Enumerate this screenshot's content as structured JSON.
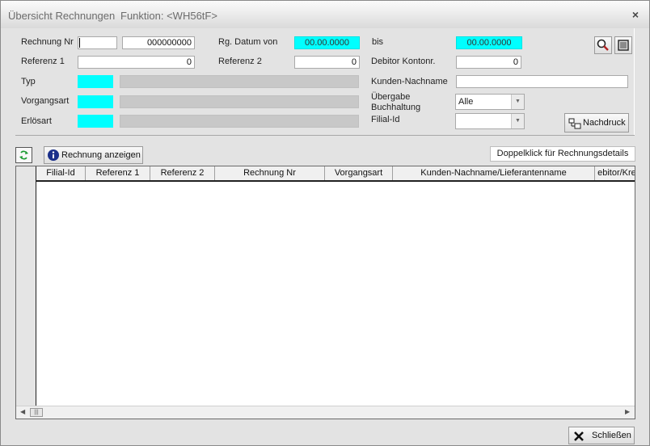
{
  "window": {
    "title": "Übersicht Rechnungen",
    "function_label": "Funktion: <WH56tF>",
    "close_glyph": "×"
  },
  "filters": {
    "rechnung_nr_label": "Rechnung Nr",
    "rechnung_nr_prefix": "",
    "rechnung_nr_value": "000000000",
    "rg_datum_von_label": "Rg. Datum von",
    "rg_datum_von_value": "00.00.0000",
    "bis_label": "bis",
    "bis_value": "00.00.0000",
    "referenz1_label": "Referenz 1",
    "referenz1_value": "0",
    "referenz2_label": "Referenz 2",
    "referenz2_value": "0",
    "debitor_label": "Debitor Kontonr.",
    "debitor_value": "0",
    "typ_label": "Typ",
    "kunden_nachname_label": "Kunden-Nachname",
    "kunden_nachname_value": "",
    "vorgangsart_label": "Vorgangsart",
    "uebergabe_label_line1": "Übergabe",
    "uebergabe_label_line2": "Buchhaltung",
    "uebergabe_value": "Alle",
    "erloesart_label": "Erlösart",
    "filial_id_label": "Filial-Id",
    "filial_id_value": ""
  },
  "toolbar": {
    "search_icon": "magnifier-icon",
    "clear_icon": "clear-filter-icon",
    "nachdruck_label": "Nachdruck",
    "refresh_icon": "refresh-icon",
    "rechnung_anzeigen_label": "Rechnung anzeigen",
    "hint_label": "Doppelklick für Rechnungsdetails"
  },
  "grid": {
    "columns": [
      "Filial-Id",
      "Referenz 1",
      "Referenz 2",
      "Rechnung Nr",
      "Vorgangsart",
      "Kunden-Nachname/Lieferantenname",
      "ebitor/Kred"
    ],
    "rows": []
  },
  "footer": {
    "close_label": "Schließen"
  },
  "colors": {
    "highlight_field": "#00ffff",
    "window_bg": "#e3e3e3"
  }
}
